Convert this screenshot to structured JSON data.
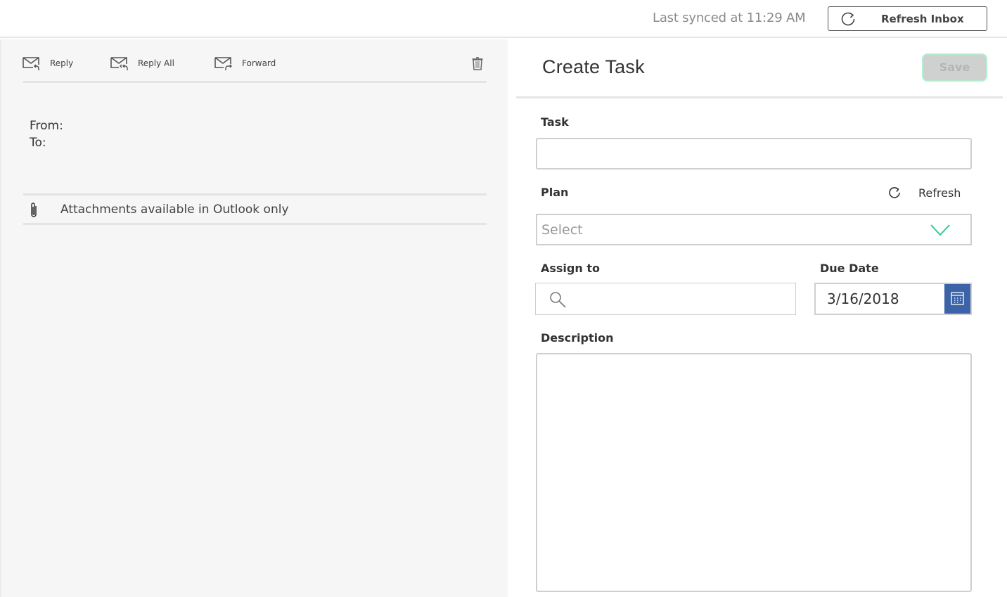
{
  "topbar": {
    "sync_text": "Last synced at 11:29 AM",
    "refresh_inbox_label": "Refresh Inbox",
    "refresh_icon": "refresh-icon"
  },
  "email": {
    "toolbar": {
      "reply_label": "Reply",
      "reply_all_label": "Reply All",
      "forward_label": "Forward",
      "delete_icon": "trash-icon"
    },
    "from_label": "From:",
    "to_label": "To:",
    "attachments_text": "Attachments available in Outlook only",
    "attachment_icon": "paperclip-icon"
  },
  "task_form": {
    "title": "Create Task",
    "save_label": "Save",
    "task_label": "Task",
    "task_value": "",
    "plan_label": "Plan",
    "plan_refresh_label": "Refresh",
    "plan_selected": "Select",
    "assign_label": "Assign to",
    "assign_value": "",
    "due_date_label": "Due Date",
    "due_date_value": "3/16/2018",
    "description_label": "Description",
    "description_value": ""
  },
  "colors": {
    "accent_green": "#2ecc8f",
    "calendar_blue": "#3c62a8",
    "save_disabled_bg": "#cfd1d0",
    "save_border": "#b5ecd0"
  }
}
